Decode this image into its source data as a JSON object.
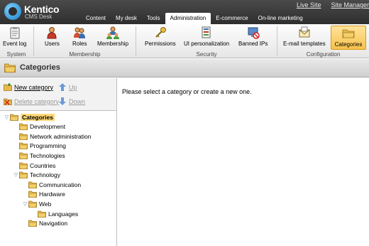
{
  "app": {
    "logo_name": "Kentico",
    "logo_sub": "CMS Desk",
    "top_links": [
      "Live Site",
      "Site Manager"
    ]
  },
  "tabs": [
    {
      "label": "Content"
    },
    {
      "label": "My desk"
    },
    {
      "label": "Tools"
    },
    {
      "label": "Administration",
      "active": true
    },
    {
      "label": "E-commerce"
    },
    {
      "label": "On-line marketing"
    }
  ],
  "ribbon": {
    "buttons": [
      {
        "label": "Event log",
        "icon": "clipboard-icon"
      },
      {
        "label": "Users",
        "icon": "user-icon"
      },
      {
        "label": "Roles",
        "icon": "roles-icon"
      },
      {
        "label": "Membership",
        "icon": "membership-icon"
      },
      {
        "label": "Permissions",
        "icon": "key-icon"
      },
      {
        "label": "UI personalization",
        "icon": "ui-personalization-icon"
      },
      {
        "label": "Banned IPs",
        "icon": "banned-ip-icon"
      },
      {
        "label": "E-mail templates",
        "icon": "envelope-icon"
      },
      {
        "label": "Categories",
        "icon": "folder-icon",
        "active": true
      }
    ],
    "groups": [
      "System",
      "Membership",
      "Security",
      "Configuration"
    ]
  },
  "page": {
    "title": "Categories",
    "message": "Please select a category or create a new one."
  },
  "actions": {
    "new_category": "New category",
    "up": "Up",
    "delete_category": "Delete category",
    "down": "Down"
  },
  "tree": [
    {
      "label": "Categories",
      "level": 0,
      "toggle": "expanded",
      "selected": true
    },
    {
      "label": "Development",
      "level": 1
    },
    {
      "label": "Network administration",
      "level": 1
    },
    {
      "label": "Programming",
      "level": 1
    },
    {
      "label": "Technologies",
      "level": 1
    },
    {
      "label": "Countries",
      "level": 1
    },
    {
      "label": "Technology",
      "level": 1,
      "toggle": "expanded"
    },
    {
      "label": "Communication",
      "level": 2
    },
    {
      "label": "Hardware",
      "level": 2
    },
    {
      "label": "Web",
      "level": 2,
      "toggle": "expanded"
    },
    {
      "label": "Languages",
      "level": 3
    },
    {
      "label": "Navigation",
      "level": 2
    }
  ],
  "colors": {
    "header_dark": "#2e2e2e",
    "selected_highlight": "#ffd977",
    "active_ribbon": "#f7c24b",
    "tree_toggle": "#5577aa"
  }
}
